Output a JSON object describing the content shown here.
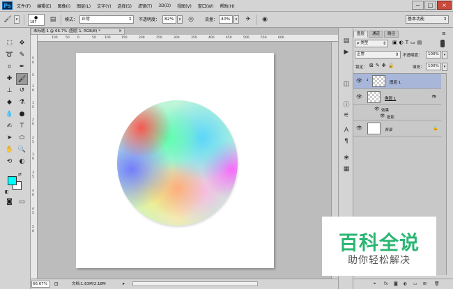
{
  "menubar": {
    "logo": "Ps",
    "items": [
      "文件(F)",
      "编辑(E)",
      "图像(I)",
      "图层(L)",
      "文字(Y)",
      "选择(S)",
      "滤镜(T)",
      "3D(D)",
      "视图(V)",
      "窗口(W)",
      "帮助(H)"
    ],
    "window_minimize": "−",
    "window_restore": "□",
    "window_close": "×"
  },
  "options": {
    "brush_size": "187",
    "mode_label": "模式：",
    "mode_value": "正常",
    "opacity_label": "不透明度：",
    "opacity_value": "82%",
    "flow_label": "流量：",
    "flow_value": "40%",
    "workspace": "基本功能"
  },
  "document": {
    "tab_title": "未标题-1 @ 66.7% (图层 1, RGB/8) *",
    "tab_close": "×",
    "ruler_ticks": [
      "100",
      "50",
      "0",
      "50",
      "100",
      "150",
      "200",
      "250",
      "300",
      "350",
      "400",
      "450",
      "500",
      "550",
      "600"
    ],
    "ruler_ticks_v": [
      "5",
      "0",
      "5",
      "1",
      "0",
      "1",
      "5",
      "2",
      "0",
      "2",
      "5",
      "3",
      "0",
      "3",
      "5",
      "4",
      "0",
      "4",
      "5",
      "5",
      "0"
    ],
    "zoom": "66.67%",
    "doc_info": "文档:1.83M/2.18M",
    "foreground_color": "#00ffff",
    "background_color": "#ffffff"
  },
  "layers_panel": {
    "tabs": [
      "图层",
      "通道",
      "路径"
    ],
    "filter_kind": "ρ 类型",
    "blend_mode": "正常",
    "opacity_label": "不透明度：",
    "opacity_value": "100%",
    "lock_label": "锁定：",
    "fill_label": "填充：",
    "fill_value": "100%",
    "layers": [
      {
        "name": "图层 1",
        "selected": true
      },
      {
        "name": "椭圆 1",
        "fx": "fx"
      },
      {
        "name": "效果",
        "sub": true
      },
      {
        "name": "投影",
        "sub": true
      },
      {
        "name": "背景",
        "locked": true
      }
    ]
  },
  "watermark": {
    "title": "百科全说",
    "subtitle": "助你轻松解决"
  }
}
